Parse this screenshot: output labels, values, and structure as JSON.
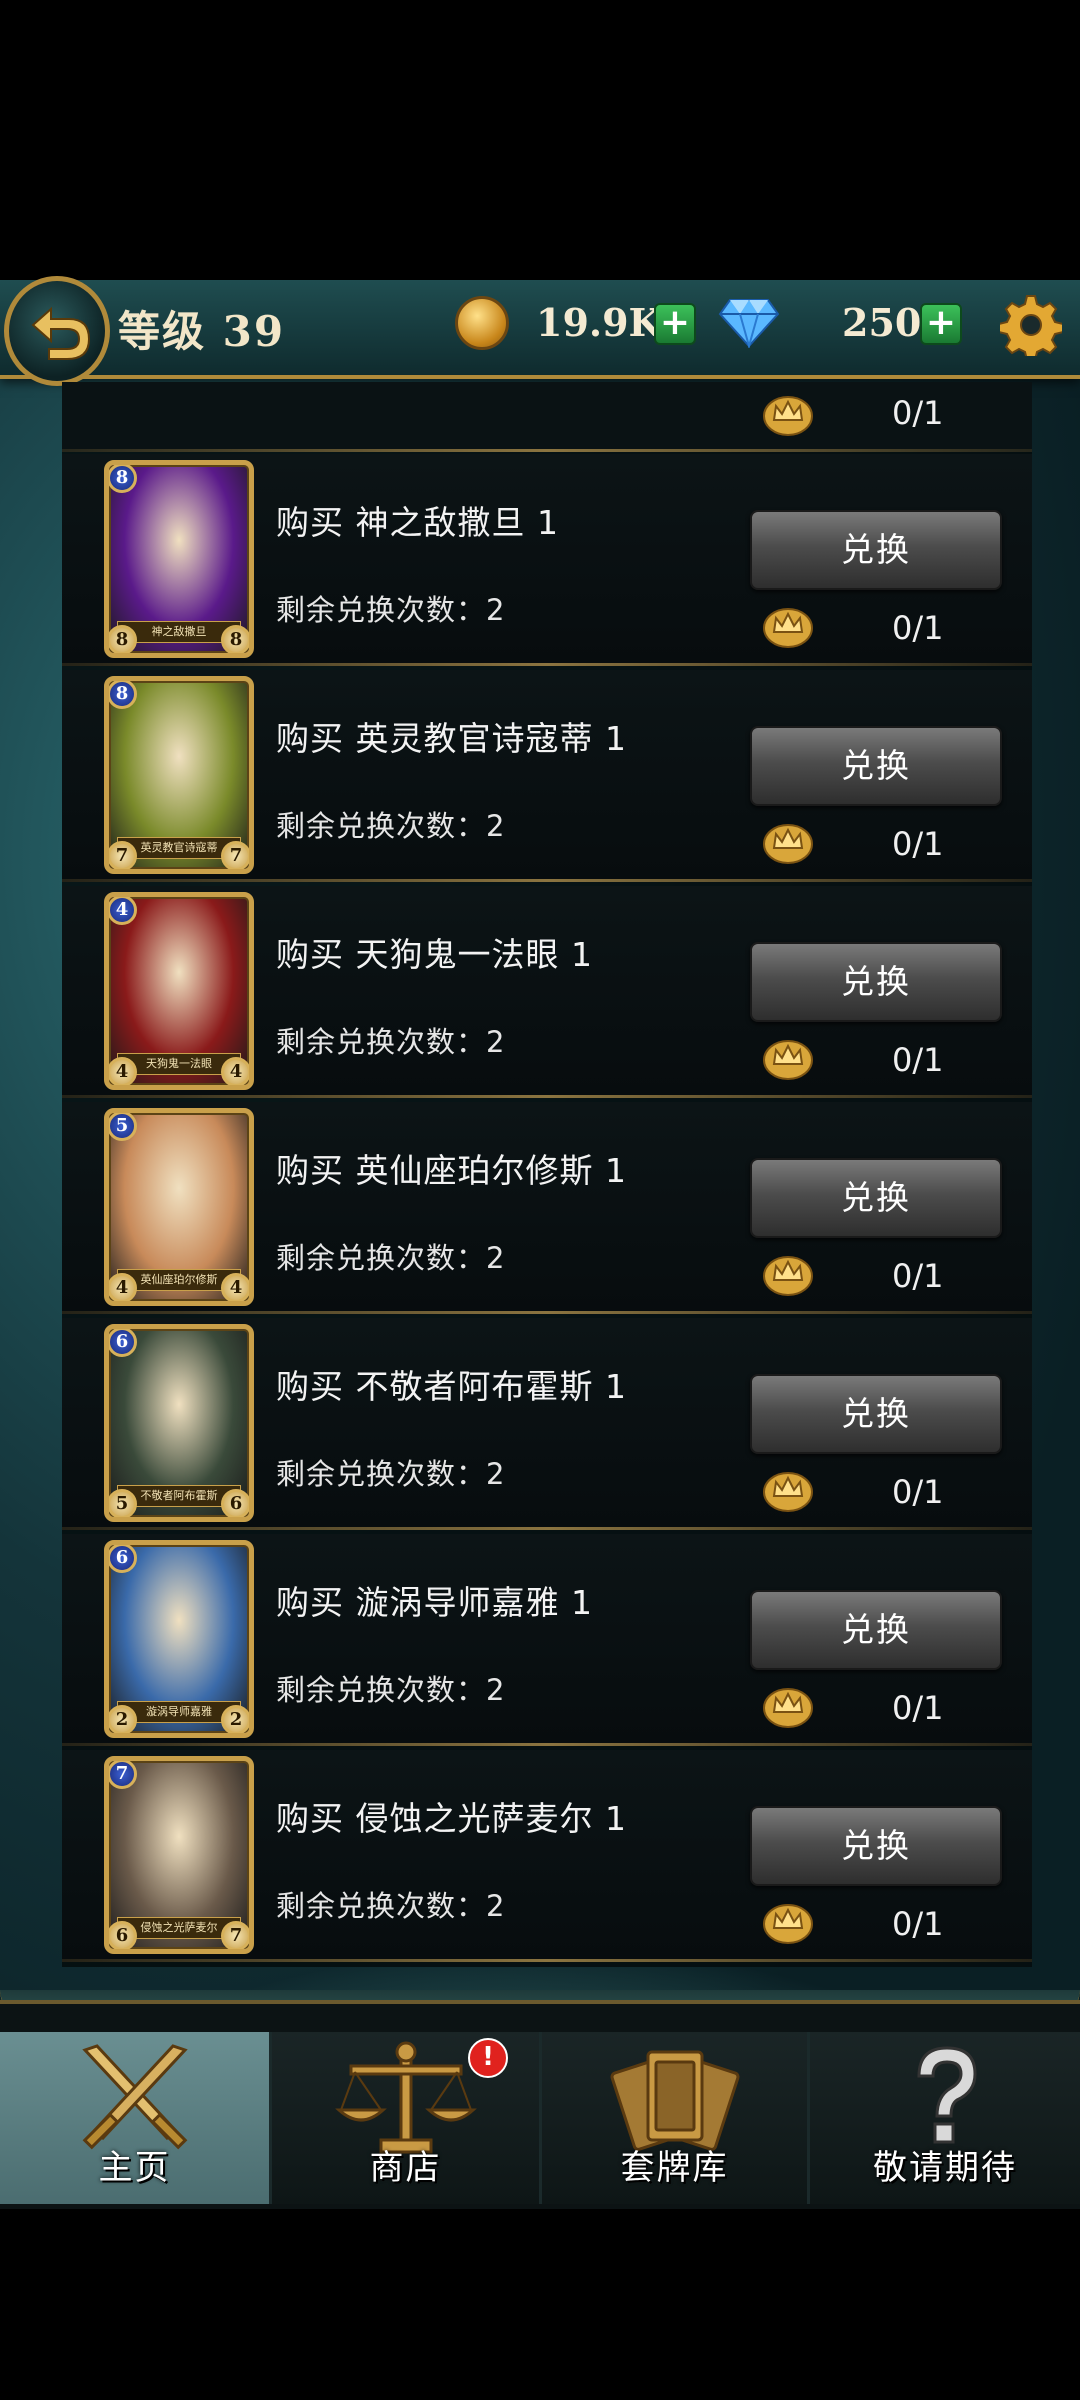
{
  "header": {
    "level_label": "等级 39",
    "coins": "19.9K",
    "gems": "250",
    "plus_symbol": "+",
    "icons": {
      "back": "back-arrow-icon",
      "coin": "gold-coin-icon",
      "gem": "diamond-icon",
      "settings": "gear-icon"
    }
  },
  "list": {
    "partial_row_progress": "0/1",
    "rows": [
      {
        "title": "购买 神之敌撒旦  1",
        "remaining": "剩余兑换次数：2",
        "button": "兑换",
        "progress": "0/1",
        "card_name": "神之敌撒旦",
        "cost": "8",
        "atk": "8",
        "hp": "8",
        "art": "#5a1a8a"
      },
      {
        "title": "购买 英灵教官诗寇蒂  1",
        "remaining": "剩余兑换次数：2",
        "button": "兑换",
        "progress": "0/1",
        "card_name": "英灵教官诗寇蒂",
        "cost": "8",
        "atk": "7",
        "hp": "7",
        "art": "#7a8a2a"
      },
      {
        "title": "购买 天狗鬼一法眼  1",
        "remaining": "剩余兑换次数：2",
        "button": "兑换",
        "progress": "0/1",
        "card_name": "天狗鬼一法眼",
        "cost": "4",
        "atk": "4",
        "hp": "4",
        "art": "#8a1a1a"
      },
      {
        "title": "购买 英仙座珀尔修斯  1",
        "remaining": "剩余兑换次数：2",
        "button": "兑换",
        "progress": "0/1",
        "card_name": "英仙座珀尔修斯",
        "cost": "5",
        "atk": "4",
        "hp": "4",
        "art": "#c88a5a"
      },
      {
        "title": "购买 不敬者阿布霍斯  1",
        "remaining": "剩余兑换次数：2",
        "button": "兑换",
        "progress": "0/1",
        "card_name": "不敬者阿布霍斯",
        "cost": "6",
        "atk": "5",
        "hp": "6",
        "art": "#3a4a3a"
      },
      {
        "title": "购买 漩涡导师嘉雅  1",
        "remaining": "剩余兑换次数：2",
        "button": "兑换",
        "progress": "0/1",
        "card_name": "漩涡导师嘉雅",
        "cost": "6",
        "atk": "2",
        "hp": "2",
        "art": "#3a6aaa"
      },
      {
        "title": "购买 侵蚀之光萨麦尔  1",
        "remaining": "剩余兑换次数：2",
        "button": "兑换",
        "progress": "0/1",
        "card_name": "侵蚀之光萨麦尔",
        "cost": "7",
        "atk": "6",
        "hp": "7",
        "art": "#6a5a4a"
      }
    ]
  },
  "nav": [
    {
      "label": "主页",
      "icon": "crossed-swords-icon",
      "active": true
    },
    {
      "label": "商店",
      "icon": "balance-scale-icon",
      "active": false,
      "badge": "!"
    },
    {
      "label": "套牌库",
      "icon": "card-deck-icon",
      "active": false
    },
    {
      "label": "敬请期待",
      "icon": "question-mark-icon",
      "active": false
    }
  ]
}
